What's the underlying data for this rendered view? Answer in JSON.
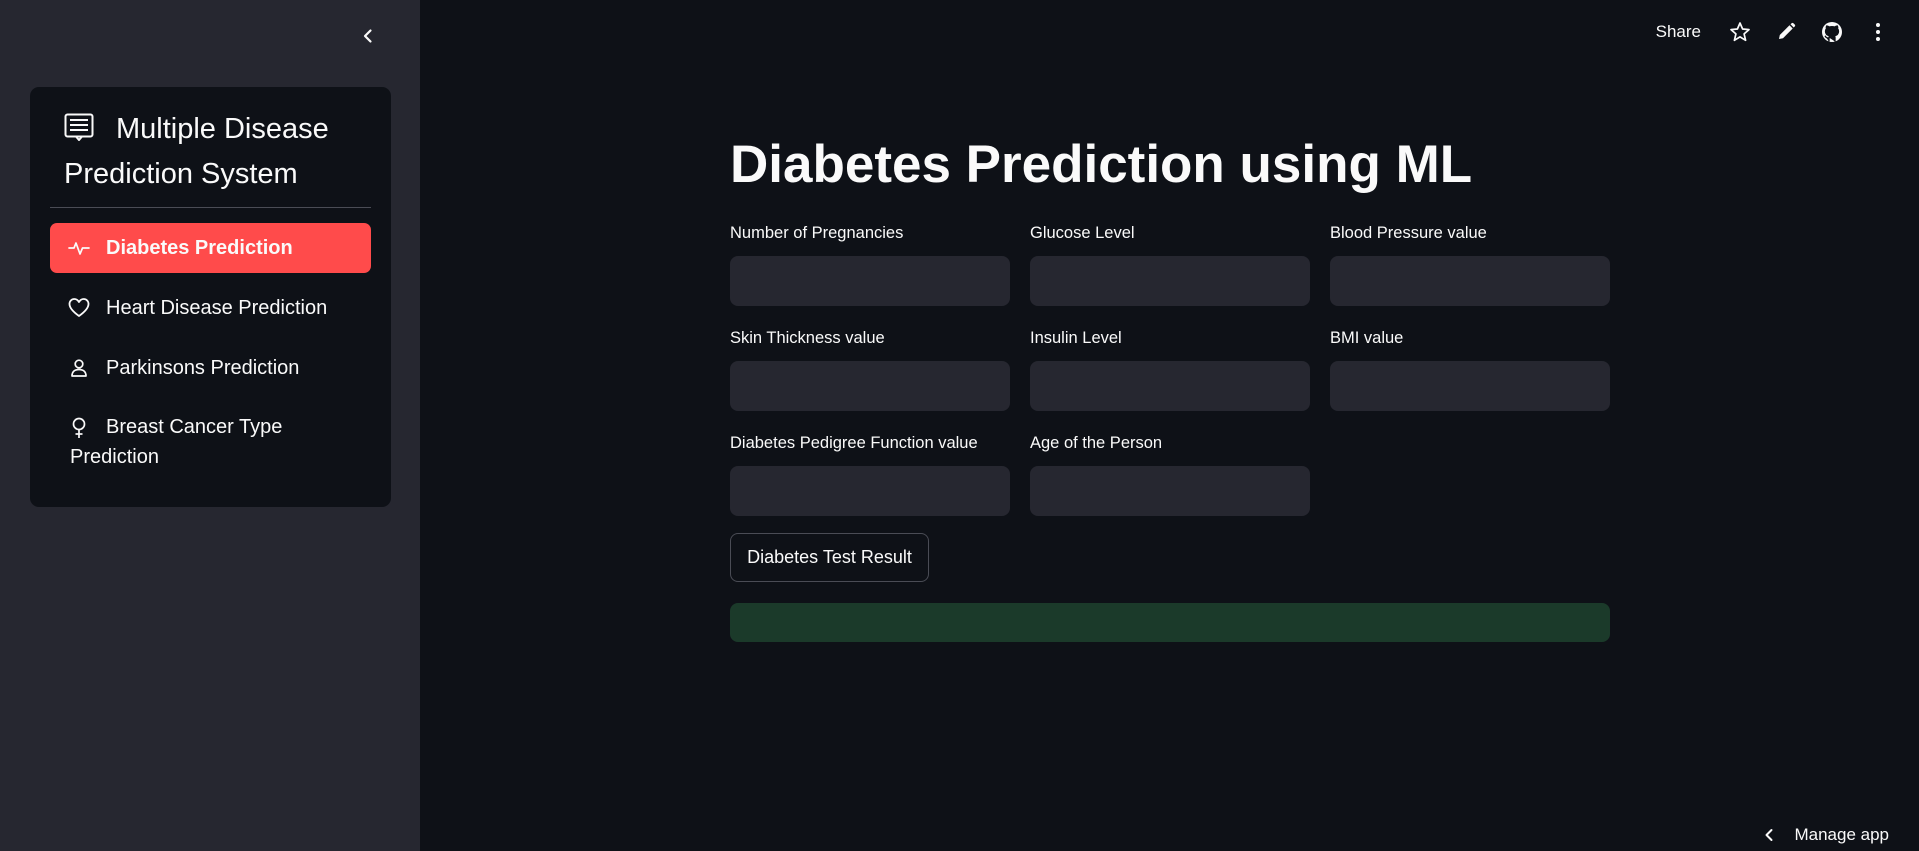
{
  "sidebar": {
    "menu_title": "Multiple Disease Prediction System",
    "items": [
      {
        "label": "Diabetes Prediction",
        "icon": "activity-icon",
        "active": true
      },
      {
        "label": "Heart Disease Prediction",
        "icon": "heart-icon",
        "active": false
      },
      {
        "label": "Parkinsons Prediction",
        "icon": "person-icon",
        "active": false
      },
      {
        "label": "Breast Cancer Type Prediction",
        "icon": "gender-female-icon",
        "active": false
      }
    ]
  },
  "toolbar": {
    "share_label": "Share",
    "icons": [
      "star-icon",
      "pencil-icon",
      "github-icon",
      "more-vertical-icon"
    ]
  },
  "main": {
    "title": "Diabetes Prediction using ML",
    "fields": [
      {
        "label": "Number of Pregnancies",
        "value": ""
      },
      {
        "label": "Glucose Level",
        "value": ""
      },
      {
        "label": "Blood Pressure value",
        "value": ""
      },
      {
        "label": "Skin Thickness value",
        "value": ""
      },
      {
        "label": "Insulin Level",
        "value": ""
      },
      {
        "label": "BMI value",
        "value": ""
      },
      {
        "label": "Diabetes Pedigree Function value",
        "value": ""
      },
      {
        "label": "Age of the Person",
        "value": ""
      }
    ],
    "submit_label": "Diabetes Test Result",
    "result_text": ""
  },
  "footer": {
    "manage_app_label": "Manage app"
  },
  "colors": {
    "accent": "#ff4b4b",
    "background": "#0e1117",
    "sidebar": "#262730",
    "success_bg": "#1b3a2a"
  }
}
